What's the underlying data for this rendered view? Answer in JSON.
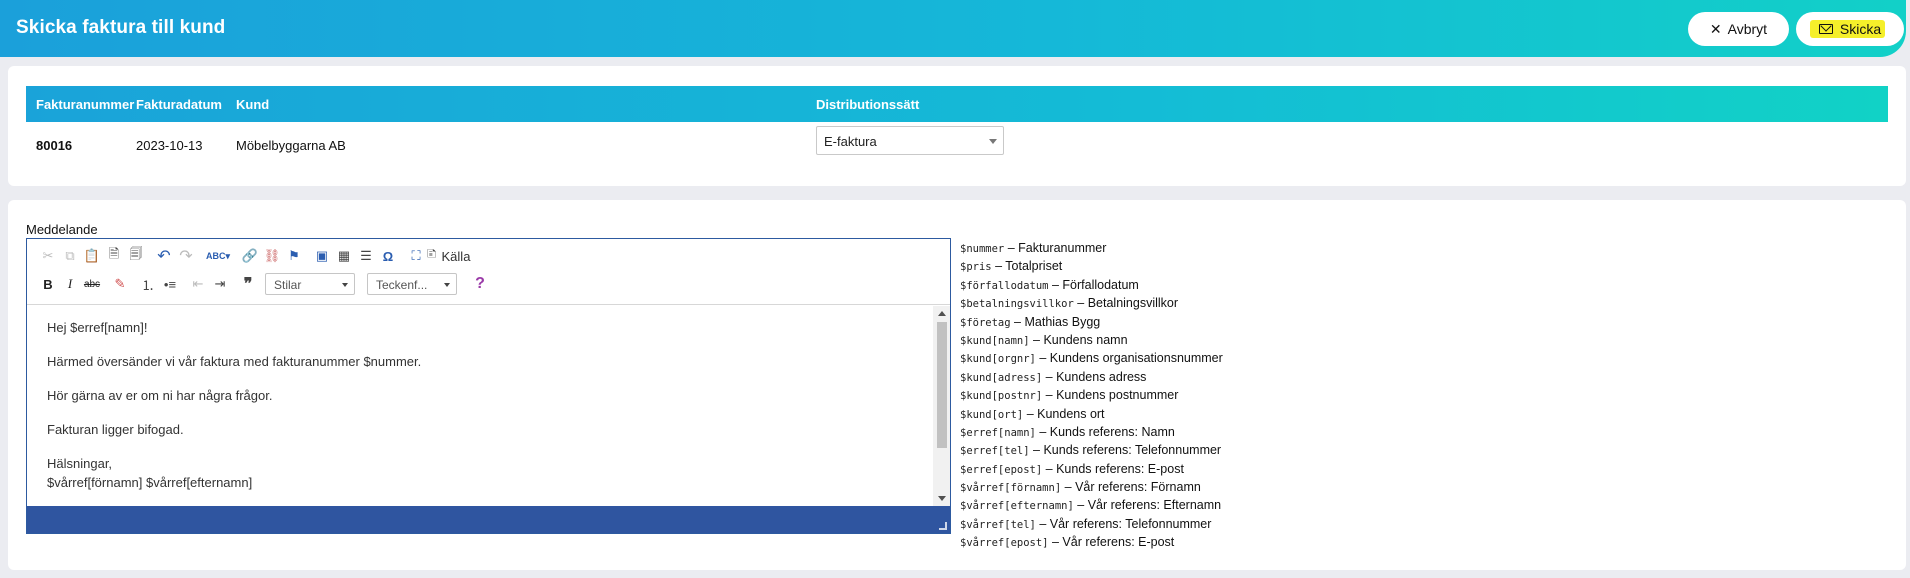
{
  "header": {
    "title": "Skicka faktura till kund",
    "cancel_label": "Avbryt",
    "send_label": "Skicka",
    "accent_color": "#1ba0da",
    "highlight_color": "#f5ef2a"
  },
  "invoice_table": {
    "columns": [
      "Fakturanummer",
      "Fakturadatum",
      "Kund",
      "Distributionssätt"
    ],
    "row": {
      "number": "80016",
      "date": "2023-10-13",
      "customer": "Möbelbyggarna AB",
      "distribution": "E-faktura"
    }
  },
  "message": {
    "label": "Meddelande",
    "toolbar": {
      "source_label": "Källa",
      "styles_placeholder": "Stilar",
      "format_placeholder": "Teckenf..."
    },
    "paragraphs": [
      "Hej $erref[namn]!",
      "Härmed översänder vi vår faktura med fakturanummer $nummer.",
      "Hör gärna av er om ni har några frågor.",
      "Fakturan ligger bifogad.",
      "Hälsningar,",
      "$vårref[förnamn] $vårref[efternamn]"
    ]
  },
  "variables": [
    {
      "code": "$nummer",
      "desc": "Fakturanummer"
    },
    {
      "code": "$pris",
      "desc": "Totalpriset"
    },
    {
      "code": "$förfallodatum",
      "desc": "Förfallodatum"
    },
    {
      "code": "$betalningsvillkor",
      "desc": "Betalningsvillkor"
    },
    {
      "code": "$företag",
      "desc": "Mathias Bygg"
    },
    {
      "code": "$kund[namn]",
      "desc": "Kundens namn"
    },
    {
      "code": "$kund[orgnr]",
      "desc": "Kundens organisationsnummer"
    },
    {
      "code": "$kund[adress]",
      "desc": "Kundens adress"
    },
    {
      "code": "$kund[postnr]",
      "desc": "Kundens postnummer"
    },
    {
      "code": "$kund[ort]",
      "desc": "Kundens ort"
    },
    {
      "code": "$erref[namn]",
      "desc": "Kunds referens: Namn"
    },
    {
      "code": "$erref[tel]",
      "desc": "Kunds referens: Telefonnummer"
    },
    {
      "code": "$erref[epost]",
      "desc": "Kunds referens: E-post"
    },
    {
      "code": "$vårref[förnamn]",
      "desc": "Vår referens: Förnamn"
    },
    {
      "code": "$vårref[efternamn]",
      "desc": "Vår referens: Efternamn"
    },
    {
      "code": "$vårref[tel]",
      "desc": "Vår referens: Telefonnummer"
    },
    {
      "code": "$vårref[epost]",
      "desc": "Vår referens: E-post"
    }
  ]
}
